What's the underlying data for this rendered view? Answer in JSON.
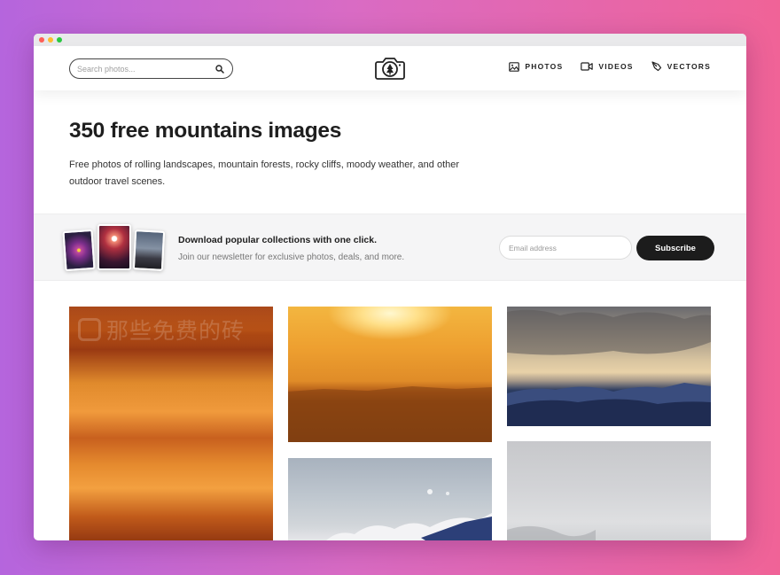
{
  "header": {
    "search_placeholder": "Search photos...",
    "logo": "camera-tree-icon",
    "nav": [
      {
        "label": "PHOTOS",
        "icon": "image-icon"
      },
      {
        "label": "VIDEOS",
        "icon": "video-icon"
      },
      {
        "label": "VECTORS",
        "icon": "pen-tool-icon"
      }
    ]
  },
  "hero": {
    "title": "350 free mountains images",
    "description": "Free photos of rolling landscapes, mountain forests, rocky cliffs, moody weather, and other outdoor travel scenes."
  },
  "newsletter": {
    "title": "Download popular collections with one click.",
    "subtitle": "Join our newsletter for exclusive photos, deals, and more.",
    "email_placeholder": "Email address",
    "button_label": "Subscribe"
  },
  "gallery": {
    "watermark": "那些免费的砖"
  },
  "colors": {
    "background_left": "#b565dd",
    "background_right": "#f06397",
    "subscribe_button": "#1c1c1c"
  }
}
